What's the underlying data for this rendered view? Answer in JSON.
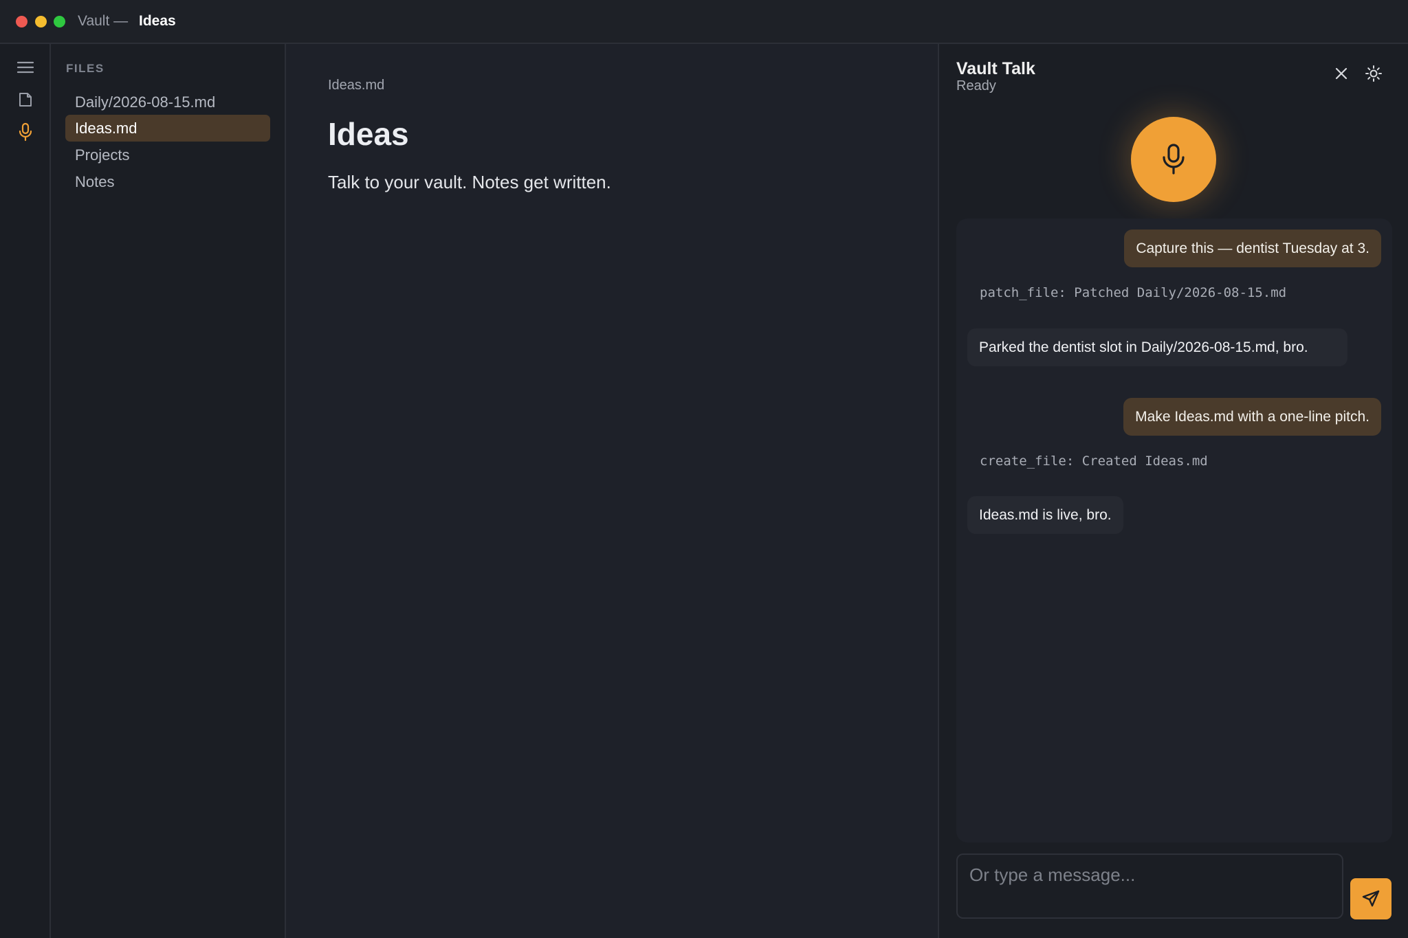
{
  "window": {
    "app_title": "Vault —",
    "doc_title": "Ideas"
  },
  "rail": {
    "icons": [
      "menu-icon",
      "file-icon",
      "mic-icon"
    ]
  },
  "files": {
    "header": "FILES",
    "items": [
      {
        "label": "Daily/2026-08-15.md",
        "active": false
      },
      {
        "label": "Ideas.md",
        "active": true
      },
      {
        "label": "Projects",
        "active": false
      },
      {
        "label": "Notes",
        "active": false
      }
    ]
  },
  "editor": {
    "breadcrumb": "Ideas.md",
    "title": "Ideas",
    "body": "Talk to your vault. Notes get written."
  },
  "chat": {
    "title": "Vault Talk",
    "status": "Ready",
    "messages": [
      {
        "role": "user",
        "text": "Capture this — dentist Tuesday at 3."
      },
      {
        "role": "tool",
        "text": "patch_file: Patched Daily/2026-08-15.md"
      },
      {
        "role": "assistant",
        "text": "Parked the dentist slot in Daily/2026-08-15.md, bro."
      },
      {
        "role": "user",
        "text": "Make Ideas.md with a one-line pitch."
      },
      {
        "role": "tool",
        "text": "create_file: Created Ideas.md"
      },
      {
        "role": "assistant",
        "text": "Ideas.md is live, bro."
      }
    ],
    "input_placeholder": "Or type a message..."
  },
  "colors": {
    "accent": "#f0a036",
    "active_item": "#4a3a2a",
    "background": "#1d2028"
  }
}
